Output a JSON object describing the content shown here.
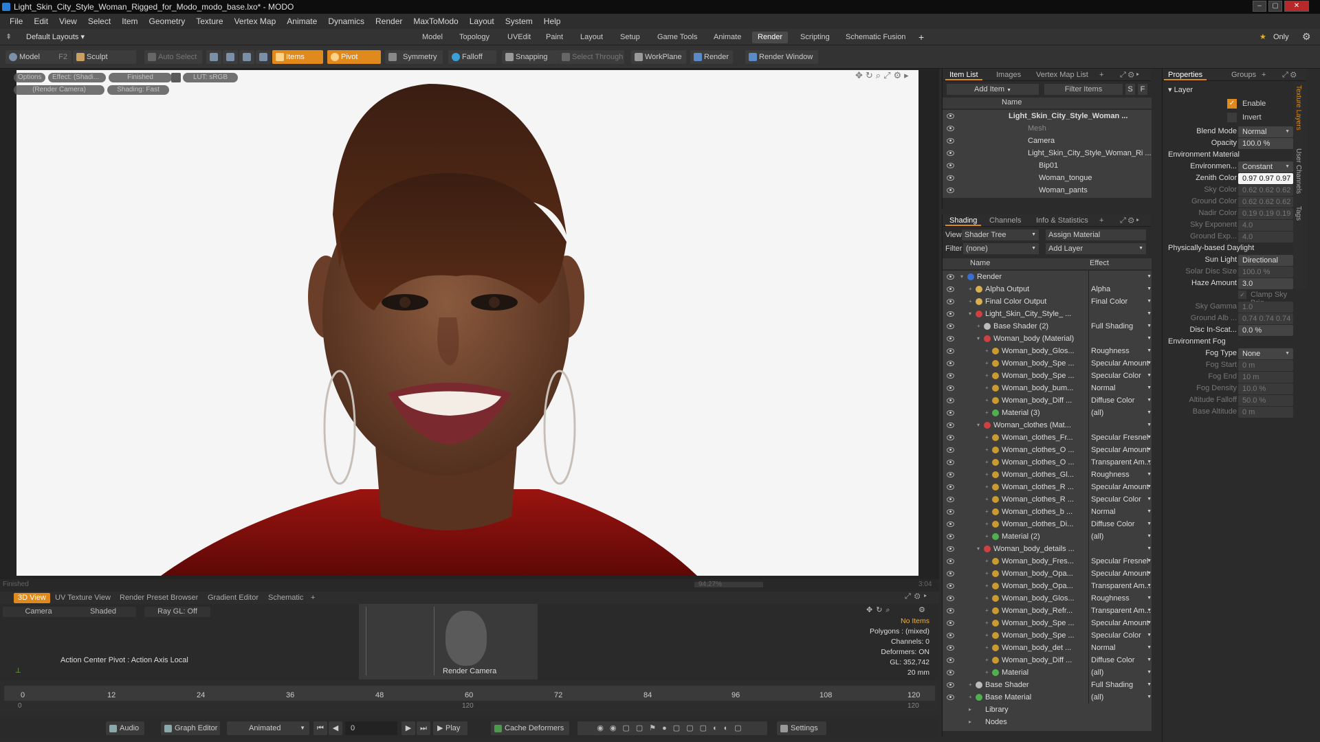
{
  "window": {
    "title": "Light_Skin_City_Style_Woman_Rigged_for_Modo_modo_base.lxo* - MODO"
  },
  "menu": [
    "File",
    "Edit",
    "View",
    "Select",
    "Item",
    "Geometry",
    "Texture",
    "Vertex Map",
    "Animate",
    "Dynamics",
    "Render",
    "MaxToModo",
    "Layout",
    "System",
    "Help"
  ],
  "layoutbar": {
    "layouts": "Default Layouts",
    "tabs": [
      "Model",
      "Topology",
      "UVEdit",
      "Paint",
      "Layout",
      "Setup",
      "Game Tools",
      "Animate",
      "Render",
      "Scripting",
      "Schematic Fusion"
    ],
    "active": "Render",
    "only": "Only"
  },
  "toolbar": {
    "model": "Model",
    "model_key": "F2",
    "sculpt": "Sculpt",
    "auto_select": "Auto Select",
    "items": "Items",
    "pivot": "Pivot",
    "symmetry": "Symmetry",
    "falloff": "Falloff",
    "snapping": "Snapping",
    "select_through": "Select Through",
    "workplane": "WorkPlane",
    "render": "Render",
    "render_window": "Render Window"
  },
  "viewport": {
    "tags": [
      "Options",
      "Effect: (Shadi...",
      "Finished",
      "LUT: sRGB",
      "(Render Camera)",
      "Shading: Fast"
    ],
    "status_left": "Finished",
    "status_right": "3:04",
    "progress": "94.27%"
  },
  "bottom": {
    "tabs": [
      "3D View",
      "UV Texture View",
      "Render Preset Browser",
      "Gradient Editor",
      "Schematic"
    ],
    "options": [
      "Camera",
      "Shaded",
      "Ray GL: Off"
    ],
    "action_center": "Action Center Pivot : Action Axis Local",
    "camera_label": "Render Camera",
    "stats": [
      "No Items",
      "Polygons : (mixed)",
      "Channels: 0",
      "Deformers: ON",
      "GL: 352,742",
      "20 mm"
    ]
  },
  "timeline": {
    "ticks": [
      "0",
      "12",
      "24",
      "36",
      "48",
      "60",
      "72",
      "84",
      "96",
      "108",
      "120"
    ],
    "sub_ticks": [
      "0",
      "120",
      "120"
    ]
  },
  "transport": {
    "audio": "Audio",
    "graph_editor": "Graph Editor",
    "animated": "Animated",
    "frame": "0",
    "play": "Play",
    "cache": "Cache Deformers",
    "settings": "Settings"
  },
  "itemlist": {
    "tabs": [
      "Item List",
      "Images",
      "Vertex Map List"
    ],
    "add_item": "Add Item",
    "filter": "Filter Items",
    "col_name": "Name",
    "rows": [
      "Light_Skin_City_Style_Woman ...",
      "Mesh",
      "Camera",
      "Light_Skin_City_Style_Woman_Ri ...",
      "Bip01",
      "Woman_tongue",
      "Woman_pants"
    ]
  },
  "shading": {
    "tabs": [
      "Shading",
      "Channels",
      "Info & Statistics"
    ],
    "view_label": "View",
    "view": "Shader Tree",
    "assign": "Assign Material",
    "filter_label": "Filter",
    "filter": "(none)",
    "add_layer": "Add Layer",
    "col_name": "Name",
    "col_effect": "Effect",
    "rows": [
      {
        "n": "Render",
        "e": "",
        "d": 0,
        "c": "#3a6fd0"
      },
      {
        "n": "Alpha Output",
        "e": "Alpha",
        "d": 1,
        "c": "#d8b050"
      },
      {
        "n": "Final Color Output",
        "e": "Final Color",
        "d": 1,
        "c": "#d8b050"
      },
      {
        "n": "Light_Skin_City_Style_  ...",
        "e": "",
        "d": 1,
        "c": "#d04040"
      },
      {
        "n": "Base Shader (2)",
        "e": "Full Shading",
        "d": 2,
        "c": "#bbbbbb"
      },
      {
        "n": "Woman_body (Material)",
        "e": "",
        "d": 2,
        "c": "#d04040"
      },
      {
        "n": "Woman_body_Glos...",
        "e": "Roughness",
        "d": 3,
        "c": "#c89a30"
      },
      {
        "n": "Woman_body_Spe ...",
        "e": "Specular Amount",
        "d": 3,
        "c": "#c89a30"
      },
      {
        "n": "Woman_body_Spe ...",
        "e": "Specular Color",
        "d": 3,
        "c": "#c89a30"
      },
      {
        "n": "Woman_body_bum...",
        "e": "Normal",
        "d": 3,
        "c": "#c89a30"
      },
      {
        "n": "Woman_body_Diff ...",
        "e": "Diffuse Color",
        "d": 3,
        "c": "#c89a30"
      },
      {
        "n": "Material (3)",
        "e": "(all)",
        "d": 3,
        "c": "#50b050"
      },
      {
        "n": "Woman_clothes (Mat...",
        "e": "",
        "d": 2,
        "c": "#d04040"
      },
      {
        "n": "Woman_clothes_Fr...",
        "e": "Specular Fresnel",
        "d": 3,
        "c": "#c89a30"
      },
      {
        "n": "Woman_clothes_O ...",
        "e": "Specular Amount",
        "d": 3,
        "c": "#c89a30"
      },
      {
        "n": "Woman_clothes_O ...",
        "e": "Transparent Am...",
        "d": 3,
        "c": "#c89a30"
      },
      {
        "n": "Woman_clothes_Gl...",
        "e": "Roughness",
        "d": 3,
        "c": "#c89a30"
      },
      {
        "n": "Woman_clothes_R ...",
        "e": "Specular Amount",
        "d": 3,
        "c": "#c89a30"
      },
      {
        "n": "Woman_clothes_R ...",
        "e": "Specular Color",
        "d": 3,
        "c": "#c89a30"
      },
      {
        "n": "Woman_clothes_b ...",
        "e": "Normal",
        "d": 3,
        "c": "#c89a30"
      },
      {
        "n": "Woman_clothes_Di...",
        "e": "Diffuse Color",
        "d": 3,
        "c": "#c89a30"
      },
      {
        "n": "Material (2)",
        "e": "(all)",
        "d": 3,
        "c": "#50b050"
      },
      {
        "n": "Woman_body_details ...",
        "e": "",
        "d": 2,
        "c": "#d04040"
      },
      {
        "n": "Woman_body_Fres...",
        "e": "Specular Fresnel",
        "d": 3,
        "c": "#c89a30"
      },
      {
        "n": "Woman_body_Opa...",
        "e": "Specular Amount",
        "d": 3,
        "c": "#c89a30"
      },
      {
        "n": "Woman_body_Opa...",
        "e": "Transparent Am...",
        "d": 3,
        "c": "#c89a30"
      },
      {
        "n": "Woman_body_Glos...",
        "e": "Roughness",
        "d": 3,
        "c": "#c89a30"
      },
      {
        "n": "Woman_body_Refr...",
        "e": "Transparent Am...",
        "d": 3,
        "c": "#c89a30"
      },
      {
        "n": "Woman_body_Spe ...",
        "e": "Specular Amount",
        "d": 3,
        "c": "#c89a30"
      },
      {
        "n": "Woman_body_Spe ...",
        "e": "Specular Color",
        "d": 3,
        "c": "#c89a30"
      },
      {
        "n": "Woman_body_det ...",
        "e": "Normal",
        "d": 3,
        "c": "#c89a30"
      },
      {
        "n": "Woman_body_Diff ...",
        "e": "Diffuse Color",
        "d": 3,
        "c": "#c89a30"
      },
      {
        "n": "Material",
        "e": "(all)",
        "d": 3,
        "c": "#50b050"
      },
      {
        "n": "Base Shader",
        "e": "Full Shading",
        "d": 1,
        "c": "#bbbbbb"
      },
      {
        "n": "Base Material",
        "e": "(all)",
        "d": 1,
        "c": "#50b050"
      },
      {
        "n": "Library",
        "e": "",
        "d": 1,
        "c": ""
      },
      {
        "n": "Nodes",
        "e": "",
        "d": 1,
        "c": ""
      }
    ]
  },
  "properties": {
    "tabs": [
      "Properties",
      "Groups"
    ],
    "side_tabs": [
      "Texture Layers",
      "User Channels",
      "Tags"
    ],
    "layer": "Layer",
    "enable": "Enable",
    "invert": "Invert",
    "fields": [
      {
        "l": "Blend Mode",
        "v": "Normal",
        "t": "dd"
      },
      {
        "l": "Opacity",
        "v": "100.0 %",
        "t": "num"
      },
      {
        "h": "Environment Material"
      },
      {
        "l": "Environmen...",
        "v": "Constant",
        "t": "dd"
      },
      {
        "l": "Zenith Color",
        "v": "0.97 0.97 0.97",
        "t": "white"
      },
      {
        "l": "Sky Color",
        "v": "0.62 0.62 0.62",
        "t": "dim"
      },
      {
        "l": "Ground Color",
        "v": "0.62 0.62 0.62",
        "t": "dim"
      },
      {
        "l": "Nadir Color",
        "v": "0.19 0.19 0.19",
        "t": "dim"
      },
      {
        "l": "Sky Exponent",
        "v": "4.0",
        "t": "dim"
      },
      {
        "l": "Ground Exp...",
        "v": "4.0",
        "t": "dim"
      },
      {
        "h": "Physically-based Daylight"
      },
      {
        "l": "Sun Light",
        "v": "Directional Light",
        "t": "dd"
      },
      {
        "l": "Solar Disc Size",
        "v": "100.0 %",
        "t": "dim"
      },
      {
        "l": "Haze Amount",
        "v": "3.0",
        "t": "num"
      },
      {
        "l": "",
        "v": "Clamp Sky Brig...",
        "t": "check"
      },
      {
        "l": "Sky Gamma",
        "v": "1.0",
        "t": "dim"
      },
      {
        "l": "Ground Alb ...",
        "v": "0.74 0.74 0.74",
        "t": "dim"
      },
      {
        "l": "Disc In-Scat...",
        "v": "0.0 %",
        "t": "num"
      },
      {
        "h": "Environment Fog"
      },
      {
        "l": "Fog Type",
        "v": "None",
        "t": "dd"
      },
      {
        "l": "Fog Start",
        "v": "0 m",
        "t": "dim"
      },
      {
        "l": "Fog End",
        "v": "10 m",
        "t": "dim"
      },
      {
        "l": "Fog Density",
        "v": "10.0 %",
        "t": "dim"
      },
      {
        "l": "Altitude Falloff",
        "v": "50.0 %",
        "t": "dim"
      },
      {
        "l": "Base Altitude",
        "v": "0 m",
        "t": "dim"
      }
    ]
  }
}
